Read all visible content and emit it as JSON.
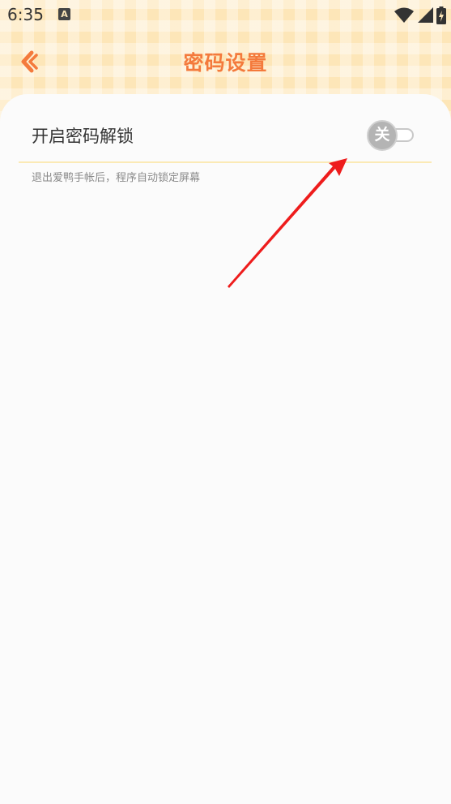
{
  "status_bar": {
    "time": "6:35",
    "notification_icon_letter": "A",
    "icons": [
      "wifi-icon",
      "signal-icon",
      "battery-charging-icon"
    ]
  },
  "header": {
    "title": "密码设置",
    "back_icon": "chevron-left-icon"
  },
  "settings": {
    "password_lock": {
      "label": "开启密码解锁",
      "toggle_state_label": "关",
      "enabled": false
    },
    "hint": "退出爱鸭手帐后，程序自动锁定屏幕"
  },
  "colors": {
    "accent": "#f47a3c",
    "header_bg": "#fde6b8",
    "card_bg": "#fbfbfb",
    "divider": "#fbeab5",
    "toggle_off": "#b4b4b4",
    "annotation_arrow": "#ee1c1c"
  }
}
